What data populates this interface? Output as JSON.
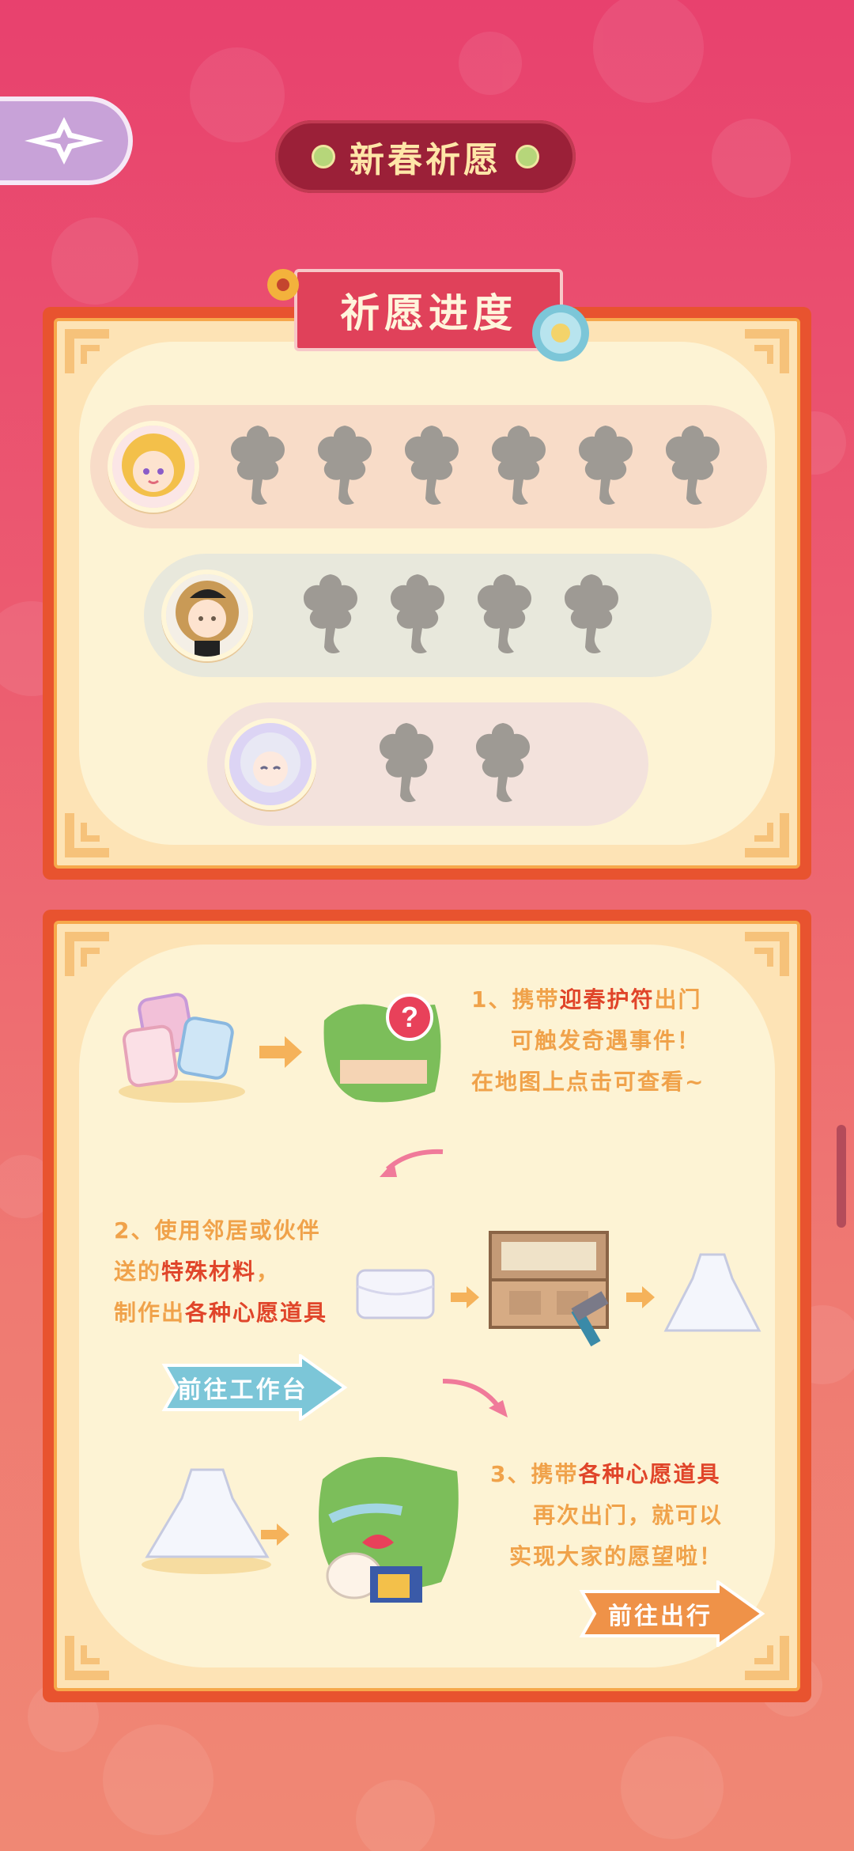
{
  "header": {
    "title": "新春祈愿",
    "back_icon": "star-compass-icon"
  },
  "progress_panel": {
    "title": "祈愿进度",
    "rows": [
      {
        "character": "blonde-girl",
        "slots": 6
      },
      {
        "character": "curly-hair-boy",
        "slots": 4
      },
      {
        "character": "silver-hair-girl",
        "slots": 2
      }
    ]
  },
  "guide_panel": {
    "step1": {
      "prefix": "1、携带",
      "highlight": "迎春护符",
      "suffix": "出门",
      "line2": "可触发奇遇事件！",
      "line3": "在地图上点击可查看~"
    },
    "step2": {
      "line1": "2、使用邻居或伙伴",
      "line2_prefix": "送的",
      "line2_highlight": "特殊材料",
      "line2_suffix": "，",
      "line3_prefix": "制作出",
      "line3_highlight": "各种心愿道具"
    },
    "step3": {
      "prefix": "3、携带",
      "highlight": "各种心愿道具",
      "line2": "再次出门，就可以",
      "line3": "实现大家的愿望啦！"
    },
    "workbench_button": "前往工作台",
    "go_out_button": "前往出行"
  },
  "colors": {
    "accent_red": "#e0452a",
    "text_orange": "#f0a24a",
    "frame_red": "#e8532f",
    "tree_gray": "#9e9a94"
  }
}
